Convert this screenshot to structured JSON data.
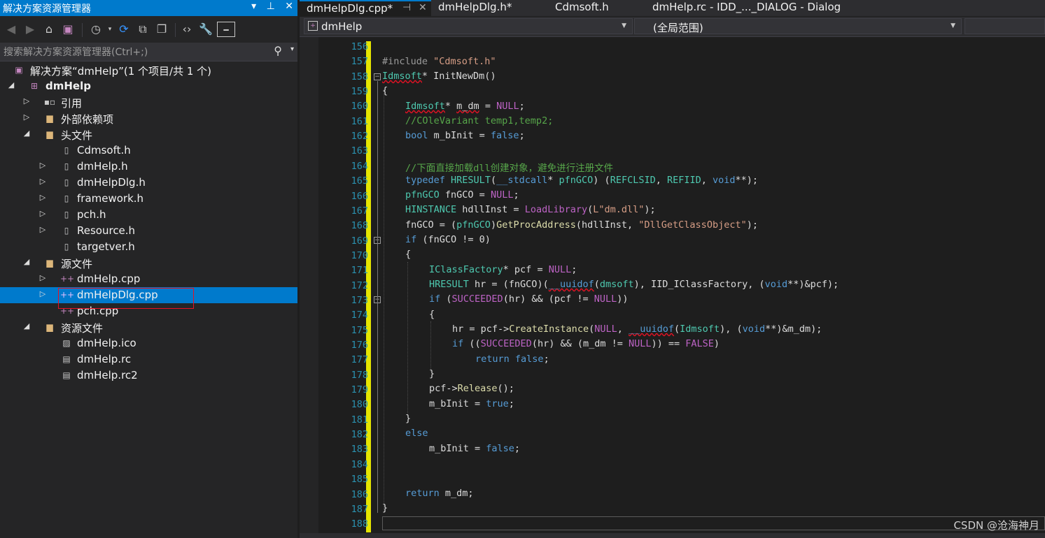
{
  "solution_explorer": {
    "title": "解决方案资源管理器",
    "search_placeholder": "搜索解决方案资源管理器(Ctrl+;)",
    "solution_label": "解决方案“dmHelp”(1 个项目/共 1 个)",
    "project": "dmHelp",
    "items": {
      "references": "引用",
      "external_deps": "外部依赖项",
      "headers": "头文件",
      "h1": "Cdmsoft.h",
      "h2": "dmHelp.h",
      "h3": "dmHelpDlg.h",
      "h4": "framework.h",
      "h5": "pch.h",
      "h6": "Resource.h",
      "h7": "targetver.h",
      "sources": "源文件",
      "s1": "dmHelp.cpp",
      "s2": "dmHelpDlg.cpp",
      "s3": "pch.cpp",
      "resources": "资源文件",
      "r1": "dmHelp.ico",
      "r2": "dmHelp.rc",
      "r3": "dmHelp.rc2"
    }
  },
  "tabs": {
    "t1": "dmHelpDlg.cpp*",
    "t2": "dmHelpDlg.h*",
    "t3": "Cdmsoft.h",
    "t4": "dmHelp.rc - IDD_..._DIALOG - Dialog"
  },
  "navbar": {
    "project": "dmHelp",
    "scope": "(全局范围)"
  },
  "line_numbers": [
    "156",
    "157",
    "158",
    "159",
    "160",
    "161",
    "162",
    "163",
    "164",
    "165",
    "166",
    "167",
    "168",
    "169",
    "170",
    "171",
    "172",
    "173",
    "174",
    "175",
    "176",
    "177",
    "178",
    "179",
    "180",
    "181",
    "182",
    "183",
    "184",
    "185",
    "186",
    "187",
    "188"
  ],
  "code": {
    "l157a": "#include ",
    "l157b": "\"Cdmsoft.h\"",
    "l158a": "Idmsoft",
    "l158b": "* InitNewDm()",
    "l159": "{",
    "l160a": "Idmsoft",
    "l160b": "* ",
    "l160c": "m_dm",
    "l160d": " = ",
    "l160e": "NULL",
    "l160f": ";",
    "l161": "//COleVariant temp1,temp2;",
    "l162a": "bool",
    "l162b": " m_bInit = ",
    "l162c": "false",
    "l162d": ";",
    "l164": "//下面直接加载dll创建对象，避免进行注册文件",
    "l165a": "typedef",
    "l165b": " ",
    "l165c": "HRESULT",
    "l165d": "(",
    "l165e": "__stdcall",
    "l165f": "* ",
    "l165g": "pfnGCO",
    "l165h": ") (",
    "l165i": "REFCLSID",
    "l165j": ", ",
    "l165k": "REFIID",
    "l165l": ", ",
    "l165m": "void",
    "l165n": "**);",
    "l166a": "pfnGCO",
    "l166b": " fnGCO = ",
    "l166c": "NULL",
    "l166d": ";",
    "l167a": "HINSTANCE",
    "l167b": " hdllInst = ",
    "l167c": "LoadLibrary",
    "l167d": "(",
    "l167e": "L\"dm.dll\"",
    "l167f": ");",
    "l168a": "fnGCO = (",
    "l168b": "pfnGCO",
    "l168c": ")",
    "l168d": "GetProcAddress",
    "l168e": "(hdllInst, ",
    "l168f": "\"DllGetClassObject\"",
    "l168g": ");",
    "l169a": "if",
    "l169b": " (fnGCO != 0)",
    "l170": "{",
    "l171a": "IClassFactory",
    "l171b": "* pcf = ",
    "l171c": "NULL",
    "l171d": ";",
    "l172a": "HRESULT",
    "l172b": " hr = (fnGCO)(",
    "l172c": "__uuidof",
    "l172d": "(",
    "l172e": "dmsoft",
    "l172f": "), IID_IClassFactory, (",
    "l172g": "void",
    "l172h": "**)&pcf);",
    "l173a": "if",
    "l173b": " (",
    "l173c": "SUCCEEDED",
    "l173d": "(hr) && (pcf != ",
    "l173e": "NULL",
    "l173f": "))",
    "l174": "{",
    "l175a": "hr = pcf->",
    "l175b": "CreateInstance",
    "l175c": "(",
    "l175d": "NULL",
    "l175e": ", ",
    "l175f": "__uuidof",
    "l175g": "(",
    "l175h": "Idmsoft",
    "l175i": "), (",
    "l175j": "void",
    "l175k": "**)&m_dm);",
    "l176a": "if",
    "l176b": " ((",
    "l176c": "SUCCEEDED",
    "l176d": "(hr) && (m_dm != ",
    "l176e": "NULL",
    "l176f": ")) == ",
    "l176g": "FALSE",
    "l176h": ")",
    "l177a": "return",
    "l177b": " ",
    "l177c": "false",
    "l177d": ";",
    "l178": "}",
    "l179a": "pcf->",
    "l179b": "Release",
    "l179c": "();",
    "l180a": "m_bInit = ",
    "l180b": "true",
    "l180c": ";",
    "l181": "}",
    "l182": "else",
    "l183a": "m_bInit = ",
    "l183b": "false",
    "l183c": ";",
    "l186a": "return",
    "l186b": " m_dm;",
    "l187": "}"
  },
  "watermark": "CSDN @沧海神月",
  "colors": {
    "accent": "#007acc",
    "selection_box": "#e81123",
    "change_bar": "#e5e500"
  }
}
